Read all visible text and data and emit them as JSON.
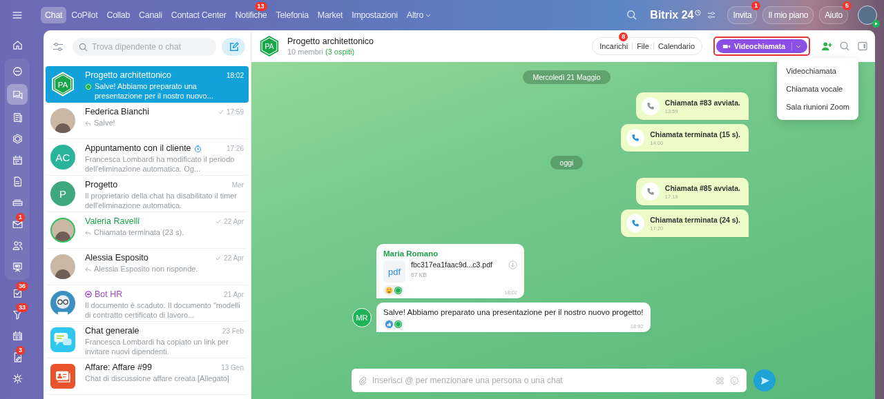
{
  "top_nav": {
    "items": [
      {
        "label": "Chat",
        "selected": true,
        "dropdown": false
      },
      {
        "label": "CoPilot",
        "selected": false,
        "dropdown": false
      },
      {
        "label": "Collab",
        "selected": false,
        "dropdown": false
      },
      {
        "label": "Canali",
        "selected": false,
        "dropdown": false
      },
      {
        "label": "Contact Center",
        "selected": false,
        "dropdown": false
      },
      {
        "label": "Notifiche",
        "selected": false,
        "dropdown": false,
        "badge": "13"
      },
      {
        "label": "Telefonia",
        "selected": false,
        "dropdown": false
      },
      {
        "label": "Market",
        "selected": false,
        "dropdown": false
      },
      {
        "label": "Impostazioni",
        "selected": false,
        "dropdown": false
      },
      {
        "label": "Altro",
        "selected": false,
        "dropdown": true
      }
    ],
    "logo": "Bitrix 24",
    "buttons": [
      {
        "label": "Invita",
        "badge": "1"
      },
      {
        "label": "Il mio piano"
      },
      {
        "label": "Aiuto",
        "badge": "5"
      }
    ]
  },
  "rail": [
    {
      "kind": "plain",
      "items": [
        {
          "kind": "home",
          "selected": false
        }
      ]
    },
    {
      "kind": "panel",
      "items": [
        {
          "kind": "copilot",
          "selected": false
        },
        {
          "kind": "chat",
          "selected": true
        },
        {
          "kind": "feed",
          "selected": false
        },
        {
          "kind": "ring",
          "selected": false
        },
        {
          "kind": "calendar",
          "selected": false
        },
        {
          "kind": "doc",
          "selected": false
        },
        {
          "kind": "drive",
          "selected": false
        },
        {
          "kind": "mail",
          "selected": false,
          "badge": "1"
        },
        {
          "kind": "people",
          "selected": false
        },
        {
          "kind": "board",
          "selected": false
        }
      ]
    },
    {
      "kind": "plain",
      "items": [
        {
          "kind": "tasks",
          "selected": false,
          "badge": "36"
        },
        {
          "kind": "funnel",
          "selected": false,
          "badge": "33"
        },
        {
          "kind": "schedule",
          "selected": false
        },
        {
          "kind": "sign",
          "selected": false,
          "badge": "3"
        },
        {
          "kind": "settings",
          "selected": false
        }
      ]
    }
  ],
  "chat_list": {
    "search": {
      "placeholder": "Trova dipendente o chat"
    },
    "chats": [
      {
        "title": "Progetto architettonico",
        "time": "18:02",
        "preview": "Salve! Abbiamo preparato una presentazione per il nostro nuovo...",
        "selected": true,
        "online": false,
        "avatar": {
          "kind": "hex",
          "initials": "PA"
        },
        "preview_icon": {
          "kind": "sender"
        }
      },
      {
        "title": "Federica Bianchi",
        "time": "17:59",
        "preview": "Salve!",
        "selected": false,
        "online": false,
        "avatar": {
          "kind": "photo"
        },
        "status_icon": {
          "kind": "read"
        },
        "preview_icon": {
          "kind": "reply"
        }
      },
      {
        "title": "Appuntamento con il cliente",
        "time": "17:26",
        "preview": "Francesca Lombardi ha modificato il periodo dell'eliminazione automatica. Og...",
        "selected": false,
        "online": false,
        "avatar": {
          "kind": "initials",
          "initials": "AC",
          "color": "#29b39b"
        },
        "title_icon": {
          "kind": "timer"
        }
      },
      {
        "title": "Progetto",
        "time": "Mer",
        "preview": "Il proprietario della chat ha disabilitato il timer dell'eliminazione automatica.",
        "selected": false,
        "online": false,
        "avatar": {
          "kind": "initials",
          "initials": "P",
          "color": "#3fa77e"
        }
      },
      {
        "title": "Valeria Ravelli",
        "time": "22 Apr",
        "preview": "Chiamata terminata (23 s).",
        "selected": false,
        "online": true,
        "avatar": {
          "kind": "photo"
        },
        "status_icon": {
          "kind": "read"
        },
        "preview_icon": {
          "kind": "reply"
        }
      },
      {
        "title": "Alessia Esposito",
        "time": "22 Apr",
        "preview": "Alessia Esposito non risponde.",
        "selected": false,
        "online": false,
        "avatar": {
          "kind": "photo"
        },
        "status_icon": {
          "kind": "read"
        },
        "preview_icon": {
          "kind": "reply"
        }
      },
      {
        "title": "Bot HR",
        "time": "21 Apr",
        "preview": "Il documento è scaduto. Il documento \"modelli di contratto certificato di lavoro...",
        "selected": false,
        "online": false,
        "avatar": {
          "kind": "bot"
        },
        "title_icon": {
          "kind": "bot"
        }
      },
      {
        "title": "Chat generale",
        "time": "23 Feb",
        "preview": "Francesca Lombardi ha copiato un link per invitare nuovi dipendenti.",
        "selected": false,
        "online": false,
        "avatar": {
          "kind": "general"
        }
      },
      {
        "title": "Affare: Affare #99",
        "time": "13 Gen",
        "preview": "Chat di discussione affare creata [Allegato]",
        "selected": false,
        "online": false,
        "avatar": {
          "kind": "deal"
        }
      }
    ]
  },
  "chat": {
    "avatar": "PA",
    "title": "Progetto architettonico",
    "members": "10 membri",
    "guests": "(3 ospiti)",
    "tools": [
      {
        "label": "Incarichi",
        "badge": "8"
      },
      {
        "label": "File"
      },
      {
        "label": "Calendario"
      }
    ],
    "call_button": {
      "label": "Videochiamata",
      "highlighted": true
    },
    "call_menu": [
      "Videochiamata",
      "Chiamata vocale",
      "Sala riunioni Zoom"
    ],
    "messages": [
      {
        "kind": "date",
        "text": "Mercoledì 21 Maggio"
      },
      {
        "kind": "call",
        "text": "Chiamata #83 avviata.",
        "time": "13:59",
        "ended": false
      },
      {
        "kind": "call",
        "text": "Chiamata terminata (15 s).",
        "time": "14:00",
        "ended": true
      },
      {
        "kind": "date",
        "text": "oggi"
      },
      {
        "kind": "call",
        "text": "Chiamata #85 avviata.",
        "time": "17:19",
        "ended": false
      },
      {
        "kind": "call",
        "text": "Chiamata terminata (24 s).",
        "time": "17:20",
        "ended": true
      },
      {
        "kind": "file",
        "author": "Maria Romano",
        "file_type": "pdf",
        "file_name": "fbc317ea1faac9d...c3.pdf",
        "size": "87 KB",
        "time": "18:02",
        "reaction": {
          "kind": "love"
        }
      },
      {
        "kind": "text",
        "text": "Salve! Abbiamo preparato una presentazione per il nostro nuovo progetto!",
        "time": "18:02",
        "reaction": {
          "kind": "like"
        },
        "avatar": "MR"
      }
    ],
    "input": {
      "placeholder": "Inserisci @ per menzionare una persona o una chat"
    }
  }
}
